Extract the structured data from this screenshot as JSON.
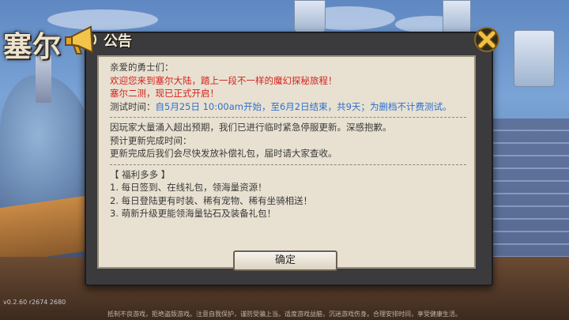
{
  "game": {
    "logo_text": "塞尔",
    "version": "v0.2.60 r2674 2680",
    "health_notice": "抵制不良游戏，拒绝盗版游戏。注意自我保护，谨防受骗上当。适度游戏益脑，沉迷游戏伤身。合理安排时间，享受健康生活。"
  },
  "dialog": {
    "title": "公告",
    "greeting": "亲爱的勇士们：",
    "welcome": "欢迎您来到塞尔大陆，踏上一段不一样的魔幻探秘旅程！",
    "launch": "塞尔二测，现已正式开启！",
    "test_time_label": "测试时间：",
    "test_time_value": "自5月25日 10:00am开始，至6月2日结束，共9天；为删档不计费测试。",
    "maintenance_lines": [
      "因玩家大量涌入超出预期，我们已进行临时紧急停服更新。深感抱歉。",
      "预计更新完成时间：",
      "更新完成后我们会尽快发放补偿礼包，届时请大家查收。"
    ],
    "benefits_title": "【 福利多多 】",
    "benefits": [
      "1. 每日签到、在线礼包，领海量资源！",
      "2. 每日登陆更有时装、稀有宠物、稀有坐骑相送！",
      "3. 萌新升级更能领海量钻石及装备礼包！"
    ],
    "confirm_label": "确定"
  },
  "icons": {
    "announcement": "megaphone-icon",
    "close": "close-icon"
  },
  "colors": {
    "highlight_red": "#d2231e",
    "highlight_blue": "#2c6fd0",
    "panel_bg": "#e8e1d1",
    "dialog_bg": "#3b3a3d",
    "close_gold": "#f0c040"
  }
}
